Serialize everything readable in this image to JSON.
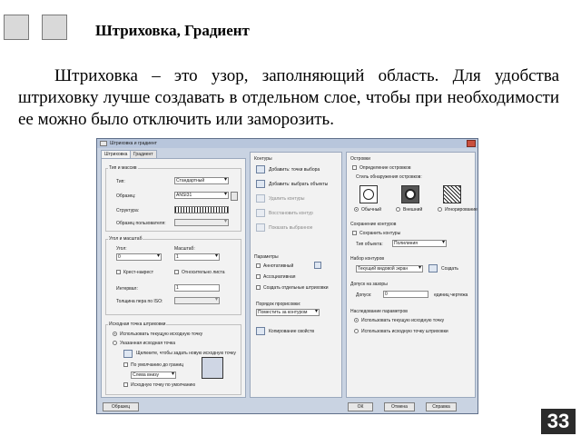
{
  "slide": {
    "title": "Штриховка, Градиент",
    "paragraph": "Штриховка – это узор, заполняющий область. Для удобства штриховку лучше создавать в отдельном слое, чтобы при необходимости ее можно было отключить или заморозить.",
    "page_number": "33"
  },
  "dialog": {
    "title": "Штриховка и градиент",
    "tabs": [
      "Штриховка",
      "Градиент"
    ],
    "left": {
      "type_group": "Тип и массив",
      "type_label": "Тип:",
      "type_value": "Стандартный",
      "pattern_label": "Образец:",
      "pattern_value": "ANSI31",
      "structure_label": "Структура:",
      "custom_label": "Образец пользователя:",
      "angle_group": "Угол и масштаб",
      "angle_label": "Угол:",
      "angle_value": "0",
      "scale_label": "Масштаб:",
      "scale_value": "1",
      "cross_label": "Крест-накрест",
      "paper_label": "Относительно листа",
      "interval_label": "Интервал:",
      "interval_value": "1",
      "iso_label": "Толщина пера по ISO:",
      "origin_group": "Исходная точка штриховки",
      "origin_current": "Использовать текущую исходную точку",
      "origin_specified": "Указанная исходная точка",
      "origin_click": "Щелкните, чтобы задать новую исходную точку",
      "origin_default": "По умолчанию до границ",
      "origin_position": "Слева внизу",
      "origin_store": "Исходную точку по умолчанию"
    },
    "middle": {
      "contours_group": "Контуры",
      "add_points": "Добавить: точки выбора",
      "add_objects": "Добавить: выбрать объекты",
      "remove_contours": "Удалить контуры",
      "recreate_contour": "Восстановить контур",
      "view_selection": "Показать выбранное",
      "options_group": "Параметры",
      "annotative": "Аннотативный",
      "associative": "Ассоциативная",
      "separate": "Создать отдельные штриховки",
      "draw_order_label": "Порядок прорисовки:",
      "draw_order_value": "Поместить за контуром",
      "inherit": "Копирование свойств"
    },
    "right": {
      "islands_group": "Островки",
      "detect_islands": "Определение островков",
      "islands_style": "Стиль обнаружения островков:",
      "normal": "Обычный",
      "outer": "Внешний",
      "ignore": "Игнорирование",
      "retain_group": "Сохранение контуров",
      "retain": "Сохранить контуры",
      "object_type_label": "Тип объекта:",
      "object_type_value": "Полилиния",
      "boundary_set_group": "Набор контуров",
      "boundary_set_value": "Текущий видовой экран",
      "new_button": "Создать",
      "gap_group": "Допуск на зазоры",
      "gap_label": "Допуск:",
      "gap_value": "0",
      "gap_units": "единиц чертежа",
      "inherit_group": "Наследование параметров",
      "inherit_current": "Использовать текущую исходную точку",
      "inherit_source": "Использовать исходную точку штриховки"
    },
    "buttons": {
      "preview": "Образец",
      "ok": "ОК",
      "cancel": "Отмена",
      "help": "Справка"
    }
  }
}
